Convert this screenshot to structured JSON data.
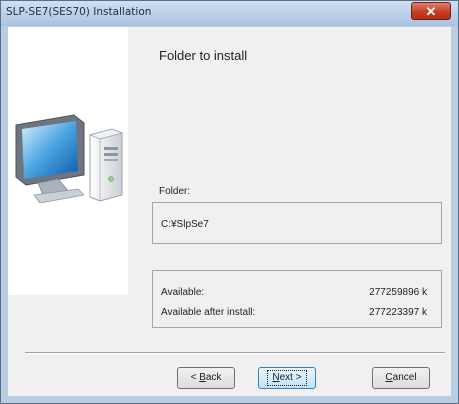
{
  "window": {
    "title": "SLP-SE7(SES70) Installation",
    "close_glyph": "✕"
  },
  "page": {
    "heading": "Folder to install",
    "illustration": "desktop-computer-icon"
  },
  "folder": {
    "label": "Folder:",
    "path": "C:¥SlpSe7"
  },
  "space": {
    "available_label": "Available:",
    "available_value": "277259896 k",
    "after_label": "Available after install:",
    "after_value": "277223397 k"
  },
  "buttons": {
    "back": {
      "prefix": "< ",
      "mnemonic": "B",
      "rest": "ack"
    },
    "next": {
      "mnemonic": "N",
      "rest": "ext >"
    },
    "cancel": {
      "mnemonic": "C",
      "rest": "ancel"
    }
  },
  "colors": {
    "close_button": "#c43d25",
    "title_bar": "#b9cde3",
    "next_button_border": "#3c7fb1"
  }
}
